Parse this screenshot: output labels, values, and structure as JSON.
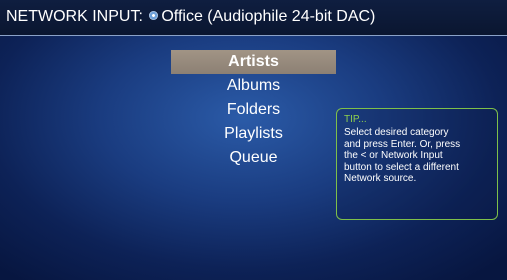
{
  "header": {
    "label": "NETWORK INPUT:",
    "source_icon": "network-source-icon",
    "source_name": "Office (Audiophile 24-bit DAC)"
  },
  "menu": {
    "items": [
      {
        "label": "Artists",
        "selected": true
      },
      {
        "label": "Albums",
        "selected": false
      },
      {
        "label": "Folders",
        "selected": false
      },
      {
        "label": "Playlists",
        "selected": false
      },
      {
        "label": "Queue",
        "selected": false
      }
    ]
  },
  "tip": {
    "title": "TIP...",
    "lines": [
      "Select desired category",
      "and press Enter. Or, press",
      "the < or Network Input",
      "button to select a different",
      "Network source."
    ]
  },
  "colors": {
    "background": "#1a3c80",
    "header": "#0f1e40",
    "selection": "#978a7d",
    "tip_border": "#7ec04a",
    "tip_title": "#8fd04e"
  }
}
